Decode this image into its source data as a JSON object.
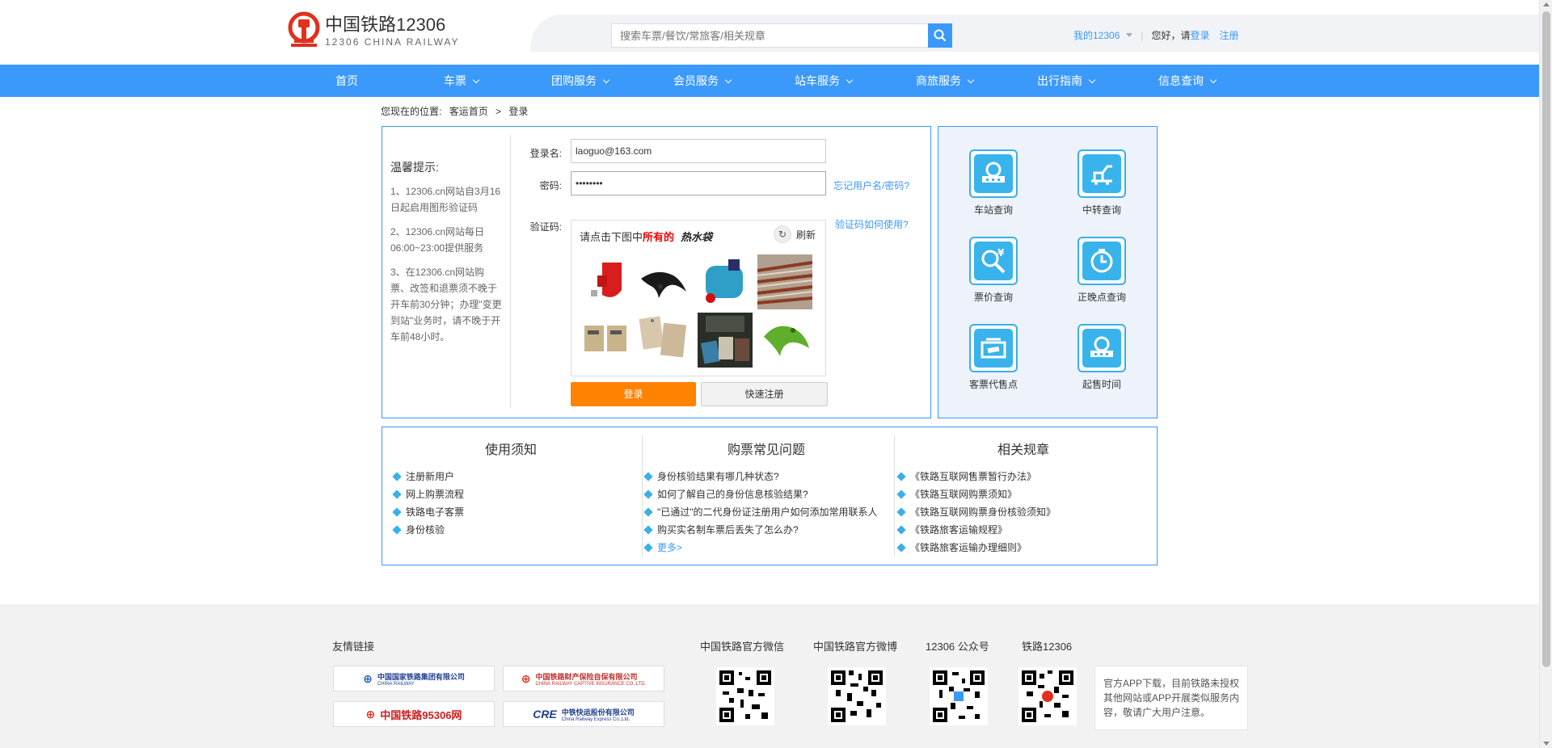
{
  "header": {
    "logo_cn": "中国铁路12306",
    "logo_en": "12306 CHINA RAILWAY",
    "search_placeholder": "搜索车票/餐饮/常旅客/相关规章",
    "my12306": "我的12306",
    "hello": "您好，请",
    "login": "登录",
    "register": "注册"
  },
  "nav": [
    {
      "label": "首页"
    },
    {
      "label": "车票"
    },
    {
      "label": "团购服务"
    },
    {
      "label": "会员服务"
    },
    {
      "label": "站车服务"
    },
    {
      "label": "商旅服务"
    },
    {
      "label": "出行指南"
    },
    {
      "label": "信息查询"
    }
  ],
  "breadcrumb": {
    "prefix": "您现在的位置:",
    "home": "客运首页",
    "sep": ">",
    "current": "登录"
  },
  "tips": {
    "title": "温馨提示:",
    "items": [
      "1、12306.cn网站自3月16日起启用图形验证码",
      "2、12306.cn网站每日06:00~23:00提供服务",
      "3、在12306.cn网站购票、改签和退票须不晚于开车前30分钟；办理\"变更到站\"业务时，请不晚于开车前48小时。"
    ]
  },
  "form": {
    "username_label": "登录名:",
    "username_value": "laoguo@163.com",
    "password_label": "密码:",
    "password_value": "••••••••",
    "forgot": "忘记用户名/密码?",
    "captcha_label": "验证码:",
    "captcha_help": "验证码如何使用?",
    "captcha_prompt": "请点击下图中",
    "captcha_all": "所有的",
    "captcha_target": "热水袋",
    "refresh": "刷新",
    "login_btn": "登录",
    "quick_reg_btn": "快速注册"
  },
  "services": [
    {
      "label": "车站查询",
      "icon": "station-icon"
    },
    {
      "label": "中转查询",
      "icon": "transfer-icon"
    },
    {
      "label": "票价查询",
      "icon": "price-search-icon"
    },
    {
      "label": "正晚点查询",
      "icon": "clock-icon"
    },
    {
      "label": "客票代售点",
      "icon": "ticket-agency-icon"
    },
    {
      "label": "起售时间",
      "icon": "sale-time-icon"
    }
  ],
  "info": {
    "col1": {
      "title": "使用须知",
      "items": [
        "注册新用户",
        "网上购票流程",
        "铁路电子客票",
        "身份核验"
      ]
    },
    "col2": {
      "title": "购票常见问题",
      "items": [
        "身份核验结果有哪几种状态?",
        "如何了解自己的身份信息核验结果?",
        "\"已通过\"的二代身份证注册用户如何添加常用联系人",
        "购买实名制车票后丢失了怎么办?"
      ],
      "more": "更多>"
    },
    "col3": {
      "title": "相关规章",
      "items": [
        "《铁路互联网售票暂行办法》",
        "《铁路互联网购票须知》",
        "《铁路互联网购票身份核验须知》",
        "《铁路旅客运输规程》",
        "《铁路旅客运输办理细则》"
      ]
    }
  },
  "footer": {
    "links_title": "友情链接",
    "partners": [
      {
        "name": "中国国家铁路集团有限公司",
        "sub": "CHINA RAILWAY"
      },
      {
        "name": "中国铁路财产保险自保有限公司",
        "sub": "CHINA RAILWAY CAPTIVE INSURANCE CO.,LTD."
      },
      {
        "name": "中国铁路95306网",
        "sub": ""
      },
      {
        "name": "中铁快运股份有限公司",
        "sub": "China Railway Express Co.,Ltd."
      }
    ],
    "qr_titles": [
      "中国铁路官方微信",
      "中国铁路官方微博",
      "12306 公众号",
      "铁路12306"
    ],
    "notice": "官方APP下载，目前铁路未授权其他网站或APP开展类似服务内容，敬请广大用户注意。"
  },
  "colors": {
    "brand_blue": "#3b99fc",
    "orange": "#ff8200",
    "logo_red": "#e0301e"
  }
}
